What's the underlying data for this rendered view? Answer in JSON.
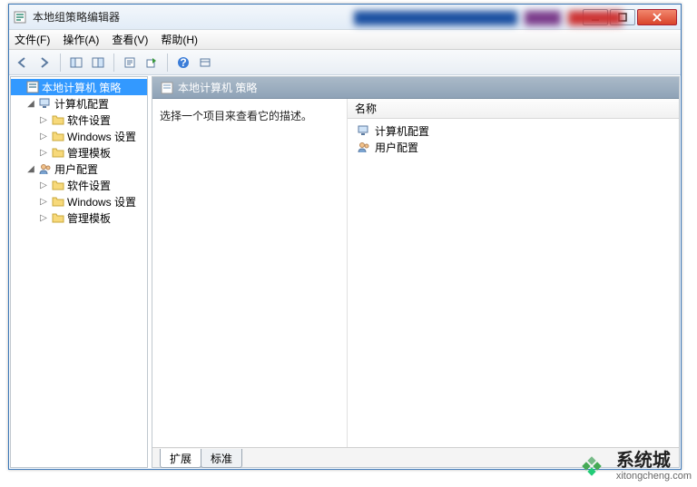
{
  "window": {
    "title": "本地组策略编辑器"
  },
  "menubar": {
    "file": "文件(F)",
    "action": "操作(A)",
    "view": "查看(V)",
    "help": "帮助(H)"
  },
  "tree": {
    "root": "本地计算机 策略",
    "groups": [
      {
        "label": "计算机配置",
        "children": [
          "软件设置",
          "Windows 设置",
          "管理模板"
        ]
      },
      {
        "label": "用户配置",
        "children": [
          "软件设置",
          "Windows 设置",
          "管理模板"
        ]
      }
    ]
  },
  "right": {
    "header": "本地计算机 策略",
    "description_prompt": "选择一个项目来查看它的描述。",
    "column_name": "名称",
    "items": [
      "计算机配置",
      "用户配置"
    ],
    "tabs": {
      "extended": "扩展",
      "standard": "标准"
    }
  },
  "watermark": {
    "brand": "系统城",
    "url": "xitongcheng.com"
  }
}
